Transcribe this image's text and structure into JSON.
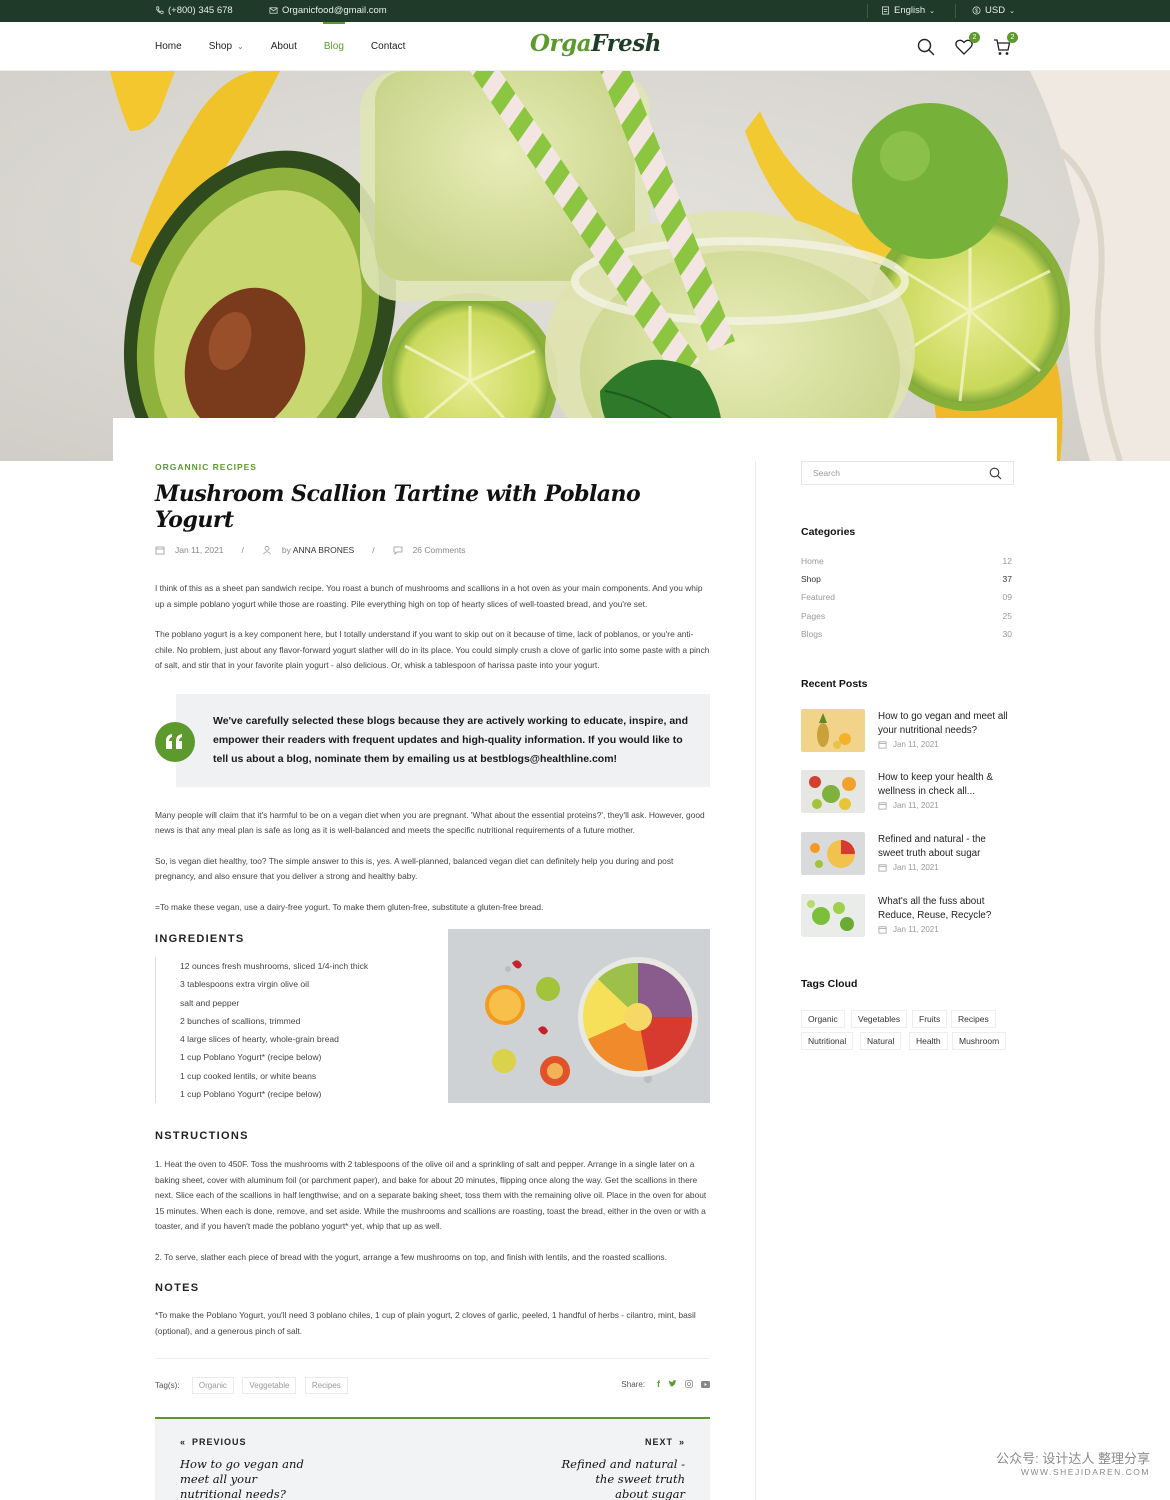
{
  "topbar": {
    "phone": "(+800) 345 678",
    "email": "Organicfood@gmail.com",
    "language": "English",
    "currency": "USD"
  },
  "header": {
    "nav": [
      "Home",
      "Shop",
      "About",
      "Blog",
      "Contact"
    ],
    "logo_part1": "Orga",
    "logo_part2": "Fresh",
    "wishlist_count": "2",
    "cart_count": "2"
  },
  "article": {
    "category": "ORGANNIC RECIPES",
    "title": "Mushroom Scallion Tartine with Poblano Yogurt",
    "date": "Jan 11, 2021",
    "author_prefix": "by",
    "author": "ANNA BRONES",
    "comments": "26 Comments",
    "para1": "I think of this as a sheet pan sandwich recipe. You roast a bunch of mushrooms and scallions in a hot oven as your main components. And you whip up a simple poblano yogurt while those are roasting. Pile everything high on top of hearty slices of well-toasted bread, and you're set.",
    "para2": "The poblano yogurt is a key component here, but I totally understand if you want to skip out on it because of time, lack of poblanos, or you're anti-chile. No problem, just about any flavor-forward yogurt slather will do in its place. You could simply crush a clove of garlic into some paste with a pinch of salt, and stir that in your favorite plain yogurt - also delicious. Or, whisk a tablespoon of harissa paste into your yogurt.",
    "quote": "We've carefully selected these blogs because they are actively working to educate, inspire, and empower their readers with frequent updates and high-quality information. If you would like to tell us about a blog, nominate them by emailing us at bestblogs@healthline.com!",
    "para3": "Many people will claim that it's harmful to be on a vegan diet when you are pregnant. 'What about the essential proteins?', they'll ask. However, good news is that any meal plan is safe as long as it is well-balanced and meets the specific nutritional requirements of a future mother.",
    "para4": "So, is vegan diet healthy, too? The simple answer to this is, yes. A well-planned, balanced vegan diet can definitely help you during and post pregnancy, and also ensure that you deliver a strong and healthy baby.",
    "para5": "=To make these vegan, use a dairy-free yogurt. To make them gluten-free, substitute a gluten-free bread.",
    "ingredients_heading": "INGREDIENTS",
    "ingredients": [
      "12 ounces fresh mushrooms, sliced 1/4-inch thick",
      "3 tablespoons extra virgin olive oil",
      "salt and pepper",
      "2 bunches of scallions, trimmed",
      "4 large slices of hearty, whole-grain bread",
      "1 cup Poblano Yogurt* (recipe below)",
      "1 cup cooked lentils, or white beans",
      "1 cup Poblano Yogurt* (recipe below)"
    ],
    "instructions_heading": "NSTRUCTIONS",
    "instr1": "1. Heat the oven to 450F. Toss the mushrooms with 2 tablespoons of the olive oil and a sprinkling of salt and pepper. Arrange in a single later on a baking sheet, cover with aluminum foil (or parchment paper), and bake for about 20 minutes, flipping once along the way. Get the scallions in there next. Slice each of the scallions in half lengthwise, and on a separate baking sheet, toss them with the remaining olive oil. Place in the oven for about 15 minutes. When each is done, remove, and set aside. While the mushrooms and scallions are roasting, toast the bread, either in the oven or with a toaster, and if you haven't made the poblano yogurt* yet, whip that up as well.",
    "instr2": "2. To serve, slather each piece of bread with the yogurt, arrange a few mushrooms on top, and finish with lentils, and the roasted scallions.",
    "notes_heading": "NOTES",
    "notes": "*To make the Poblano Yogurt, you'll need 3 poblano chiles, 1 cup of plain yogurt, 2 cloves of garlic, peeled, 1 handful of herbs - cilantro, mint, basil (optional), and a generous pinch of salt.",
    "tags_label": "Tag(s):",
    "tags": [
      "Organic",
      "Veggetable",
      "Recipes"
    ],
    "share_label": "Share:"
  },
  "pager": {
    "prev_label": "PREVIOUS",
    "prev_title": "How to go vegan and meet all your nutritional needs?",
    "next_label": "NEXT",
    "next_title": "Refined and natural - the sweet truth about sugar"
  },
  "sidebar": {
    "search_placeholder": "Search",
    "categories_heading": "Categories",
    "categories": [
      {
        "name": "Home",
        "count": "12"
      },
      {
        "name": "Shop",
        "count": "37"
      },
      {
        "name": "Featured",
        "count": "09"
      },
      {
        "name": "Pages",
        "count": "25"
      },
      {
        "name": "Blogs",
        "count": "30"
      }
    ],
    "recent_heading": "Recent Posts",
    "recent": [
      {
        "title": "How to go vegan and meet all your nutritional needs?",
        "date": "Jan 11, 2021"
      },
      {
        "title": "How to keep your health & wellness in check all...",
        "date": "Jan 11, 2021"
      },
      {
        "title": "Refined and natural - the sweet truth about sugar",
        "date": "Jan 11, 2021"
      },
      {
        "title": "What's all the fuss about Reduce, Reuse, Recycle?",
        "date": "Jan 11, 2021"
      }
    ],
    "tags_heading": "Tags Cloud",
    "tags": [
      "Organic",
      "Vegetables",
      "Fruits",
      "Recipes",
      "Nutritional",
      "Natural",
      "Health",
      "Mushroom"
    ]
  },
  "watermark": {
    "line1": "公众号: 设计达人 整理分享",
    "line2": "WWW.SHEJIDAREN.COM"
  },
  "colors": {
    "accent": "#5d9a2e",
    "topbar": "#1f3a28"
  }
}
